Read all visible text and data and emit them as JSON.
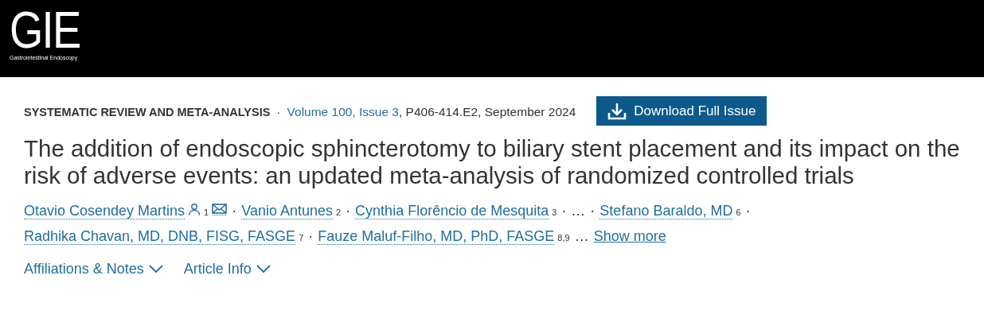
{
  "header": {
    "logo": {
      "mark": "GIE",
      "subtitle": "Gastrointestinal Endoscopy"
    }
  },
  "article": {
    "category": "SYSTEMATIC REVIEW AND META-ANALYSIS",
    "dot": "·",
    "issue_link": "Volume 100, Issue 3",
    "citation": ", P406-414.E2, September 2024",
    "download_button": "Download Full Issue",
    "title": "The addition of endoscopic sphincterotomy to biliary stent placement and its impact on the risk of adverse events: an updated meta-analysis of randomized controlled trials",
    "author_lines": [
      [
        {
          "kind": "author",
          "name": "Otavio Cosendey Martins",
          "profile": true,
          "note": "1",
          "email": true,
          "separator": "·"
        },
        {
          "kind": "author",
          "name": "Vanio Antunes",
          "note": "2",
          "separator": "·"
        },
        {
          "kind": "author",
          "name": "Cynthia Florêncio de Mesquita",
          "note": "3",
          "separator": "·"
        },
        {
          "kind": "ellipsis",
          "text": "…",
          "separator": "·"
        },
        {
          "kind": "author",
          "name": "Stefano Baraldo, MD",
          "note": "6",
          "separator": "·"
        }
      ],
      [
        {
          "kind": "author",
          "name": "Radhika Chavan, MD, DNB, FISG, FASGE",
          "note": "7",
          "separator": "·"
        },
        {
          "kind": "author",
          "name": "Fauze Maluf-Filho, MD, PhD, FASGE",
          "note": "8,9"
        },
        {
          "kind": "ellipsis",
          "text": "…"
        },
        {
          "kind": "more",
          "text": "Show more"
        }
      ]
    ],
    "toggles": [
      {
        "label": "Affiliations & Notes",
        "expanded": false
      },
      {
        "label": "Article Info",
        "expanded": false
      }
    ]
  }
}
